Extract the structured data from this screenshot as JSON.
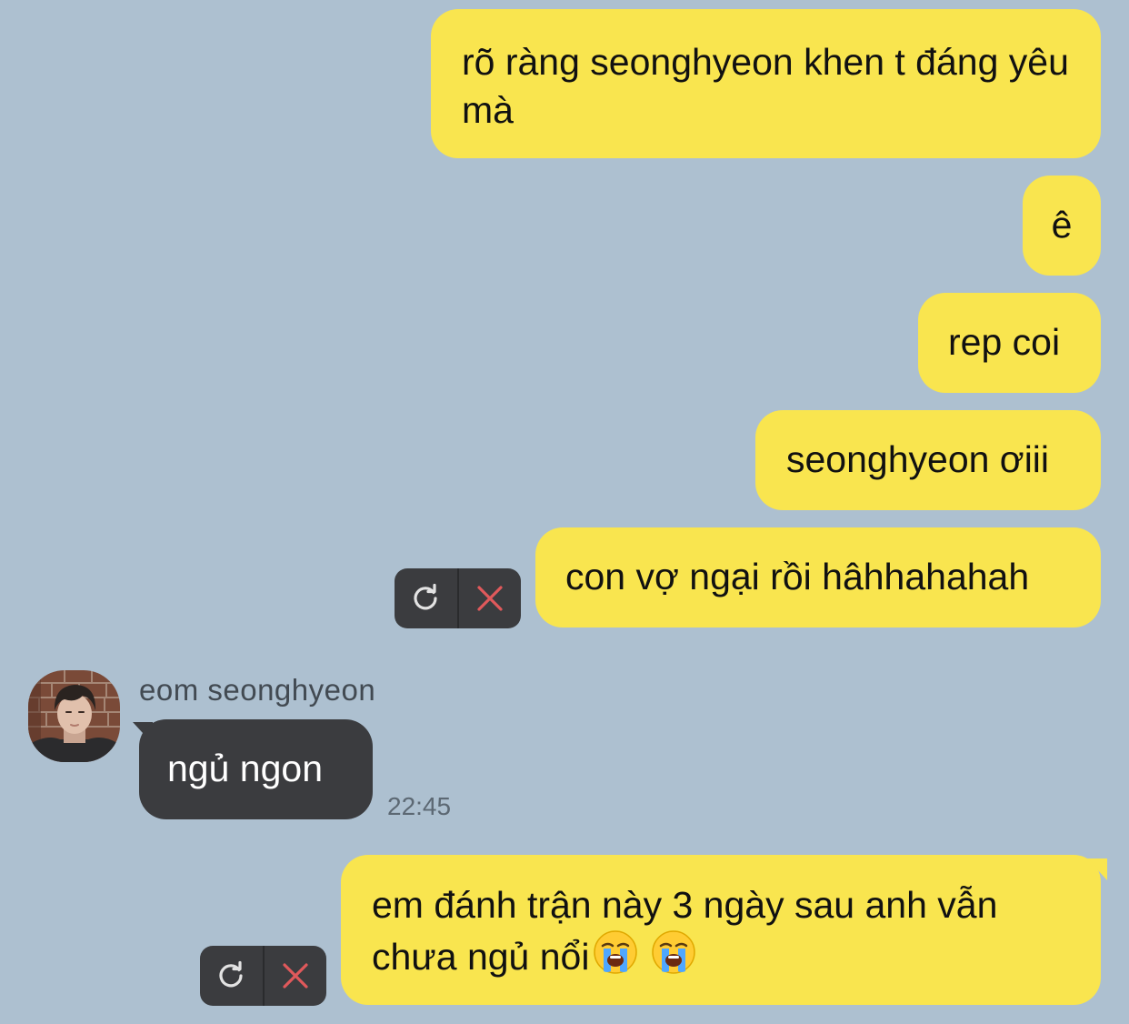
{
  "theme": {
    "background": "#adc0d0",
    "outgoing_bubble": "#f9e54f",
    "incoming_bubble": "#3b3c3f",
    "retry_icon_color": "#e3e3e3",
    "delete_icon_color": "#e0595b"
  },
  "messages": [
    {
      "direction": "outgoing",
      "text": "rõ ràng seonghyeon khen t đáng yêu mà"
    },
    {
      "direction": "outgoing",
      "text": "ê"
    },
    {
      "direction": "outgoing",
      "text": "rep coi"
    },
    {
      "direction": "outgoing",
      "text": "seonghyeon ơiii"
    },
    {
      "direction": "outgoing",
      "text": "con vợ ngại rồi hâhhahahah",
      "status": "failed",
      "actions": [
        "retry-icon",
        "delete-icon"
      ]
    },
    {
      "direction": "incoming",
      "sender": "eom seonghyeon",
      "text": "ngủ ngon",
      "time": "22:45"
    },
    {
      "direction": "outgoing",
      "text": "em đánh trận này 3 ngày sau anh vẫn chưa ngủ nổi",
      "emoji": [
        "loudly-crying-face",
        "loudly-crying-face"
      ],
      "status": "failed",
      "actions": [
        "retry-icon",
        "delete-icon"
      ]
    }
  ]
}
